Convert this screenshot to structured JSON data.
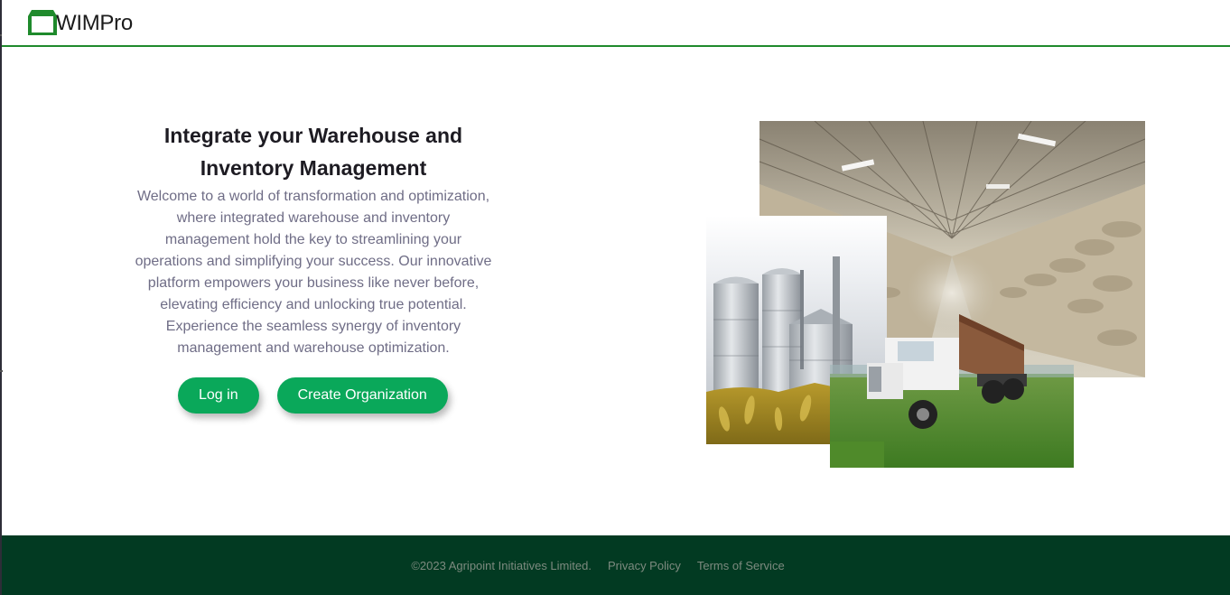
{
  "brand": {
    "name": "WIMPro",
    "logo_icon": "warehouse-icon",
    "color": "#1f8a2c"
  },
  "hero": {
    "title_line1": "Integrate your Warehouse and",
    "title_line2": "Inventory Management",
    "description": "Welcome to a world of transformation and optimization, where integrated warehouse and inventory management hold the key to streamlining your operations and simplifying your success. Our innovative platform empowers your business like never before, elevating efficiency and unlocking true potential. Experience the seamless synergy of inventory management and warehouse optimization."
  },
  "actions": {
    "login_label": "Log in",
    "create_org_label": "Create Organization",
    "button_color": "#0aa85a"
  },
  "images": {
    "warehouse_alt": "warehouse-interior-image",
    "silos_alt": "grain-silos-image",
    "truck_alt": "grain-truck-image"
  },
  "footer": {
    "copyright": "©2023 Agripoint Initiatives Limited.",
    "privacy_label": "Privacy Policy",
    "terms_label": "Terms of Service",
    "background": "#023a22"
  }
}
